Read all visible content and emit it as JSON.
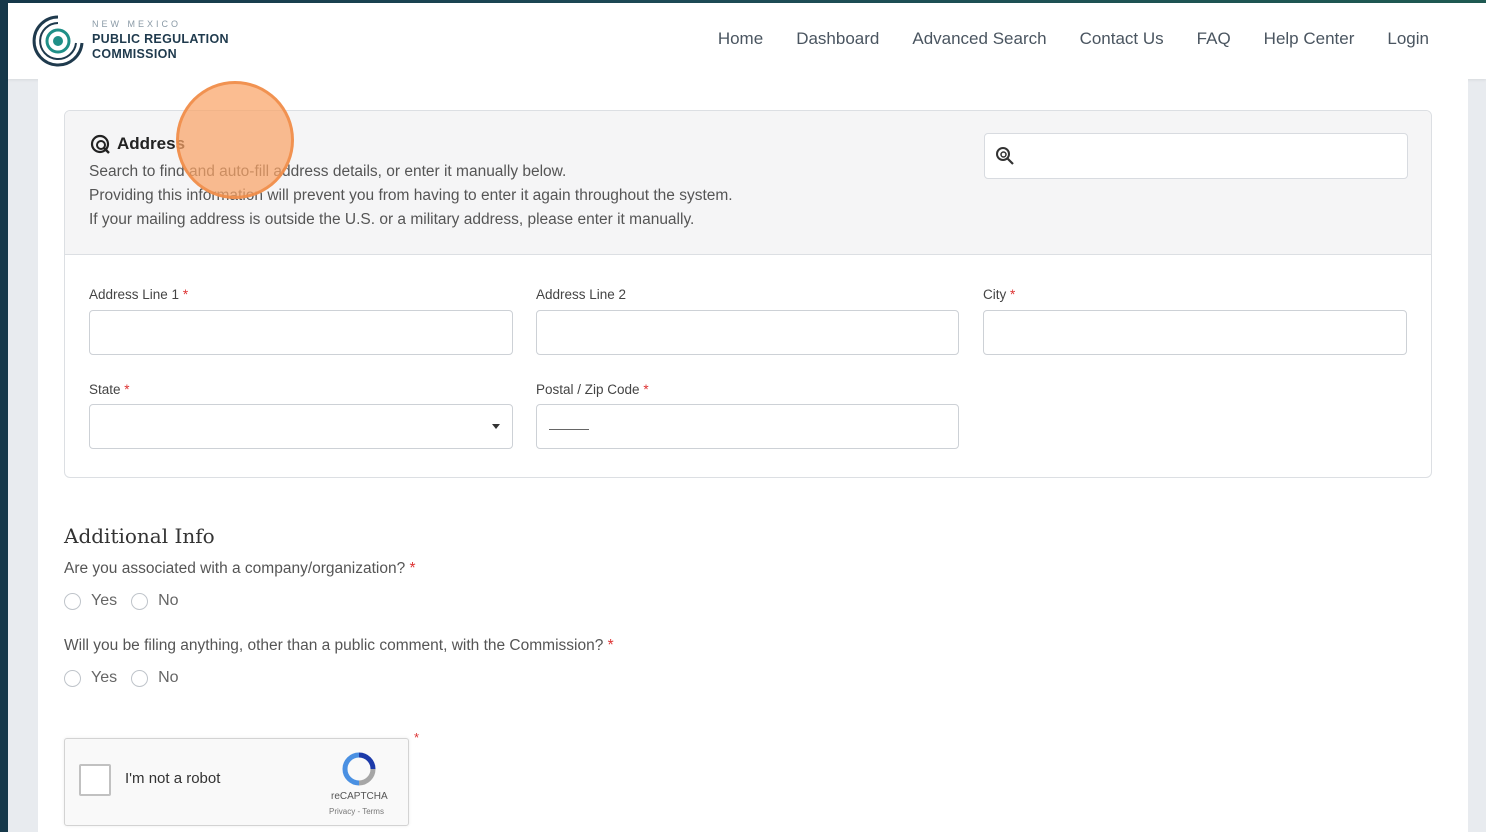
{
  "brand": {
    "sub": "NEW MEXICO",
    "line1": "PUBLIC REGULATION",
    "line2": "COMMISSION",
    "logo_icon": "prc-logo-icon"
  },
  "nav": {
    "items": [
      "Home",
      "Dashboard",
      "Advanced Search",
      "Contact Us",
      "FAQ",
      "Help Center",
      "Login"
    ]
  },
  "address": {
    "title": "Address",
    "icon": "search-location-icon",
    "desc1": "Search to find and auto-fill address details, or enter it manually below.",
    "desc2": "Providing this information will prevent you from having to enter it again throughout the system.",
    "desc3": "If your mailing address is outside the U.S. or a military address, please enter it manually.",
    "search_value": "",
    "fields": {
      "line1_label": "Address Line 1",
      "line2_label": "Address Line 2",
      "city_label": "City",
      "state_label": "State",
      "zip_label": "Postal / Zip Code",
      "required_mark": "*",
      "line1_value": "",
      "line2_value": "",
      "city_value": "",
      "state_value": "",
      "zip_value": ""
    }
  },
  "additional": {
    "heading": "Additional Info",
    "q1": "Are you associated with a company/organization?",
    "q2": "Will you be filing anything, other than a public comment, with the Commission?",
    "yes": "Yes",
    "no": "No"
  },
  "captcha": {
    "label": "I'm not a robot",
    "brand": "reCAPTCHA",
    "links": "Privacy - Terms",
    "required_mark": "*"
  },
  "colors": {
    "accent_required": "#d33333",
    "cursor_highlight": "#f9a366",
    "logo_teal": "#1f8f87"
  }
}
